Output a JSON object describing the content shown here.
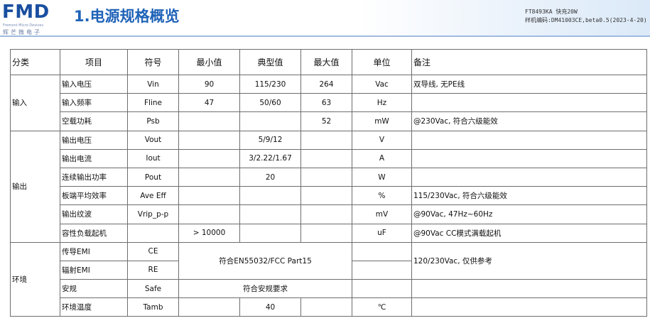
{
  "header": {
    "logo": "FMD",
    "logo_sub": "Fremont Micro Devices",
    "logo_cn": "辉芒微电子",
    "title": "1.电源规格概览",
    "meta_line1": "FT8493KA 快充20W",
    "meta_line2": "样机编码:DM41003CE,beta0.5(2023-4-20)"
  },
  "table": {
    "headers": [
      "分类",
      "项目",
      "符号",
      "最小值",
      "典型值",
      "最大值",
      "单位",
      "备注"
    ],
    "groups": {
      "input": "输入",
      "output": "输出",
      "env": "环境"
    },
    "rows": [
      {
        "item": "输入电压",
        "symbol": "Vin",
        "min": "90",
        "typ": "115/230",
        "max": "264",
        "unit": "Vac",
        "note": "双导线, 无PE线"
      },
      {
        "item": "输入频率",
        "symbol": "Fline",
        "min": "47",
        "typ": "50/60",
        "max": "63",
        "unit": "Hz",
        "note": ""
      },
      {
        "item": "空载功耗",
        "symbol": "Psb",
        "min": "",
        "typ": "",
        "max": "52",
        "unit": "mW",
        "note": "@230Vac, 符合六级能效"
      },
      {
        "item": "输出电压",
        "symbol": "Vout",
        "min": "",
        "typ": "5/9/12",
        "max": "",
        "unit": "V",
        "note": ""
      },
      {
        "item": "输出电流",
        "symbol": "Iout",
        "min": "",
        "typ": "3/2.22/1.67",
        "max": "",
        "unit": "A",
        "note": ""
      },
      {
        "item": "连续输出功率",
        "symbol": "Pout",
        "min": "",
        "typ": "20",
        "max": "",
        "unit": "W",
        "note": ""
      },
      {
        "item": "板端平均效率",
        "symbol": "Ave Eff",
        "min": "",
        "typ": "",
        "max": "",
        "unit": "%",
        "note": "115/230Vac, 符合六级能效"
      },
      {
        "item": "输出纹波",
        "symbol": "Vrip_p-p",
        "min": "",
        "typ": "",
        "max": "",
        "unit": "mV",
        "note": "@90Vac, 47Hz~60Hz"
      },
      {
        "item": "容性负载起机",
        "symbol": "",
        "min": "> 10000",
        "typ": "",
        "max": "",
        "unit": "uF",
        "note": "@90Vac CC模式满载起机"
      },
      {
        "item": "传导EMI",
        "symbol": "CE"
      },
      {
        "item": "辐射EMI",
        "symbol": "RE"
      },
      {
        "item": "安规",
        "symbol": "Safe"
      },
      {
        "item": "环境温度",
        "symbol": "Tamb",
        "min": "",
        "typ": "40",
        "max": "",
        "unit": "℃",
        "note": ""
      }
    ],
    "emi_merged": "符合EN55032/FCC Part15",
    "emi_note": "120/230Vac, 仅供参考",
    "safety_merged": "符合安规要求"
  }
}
